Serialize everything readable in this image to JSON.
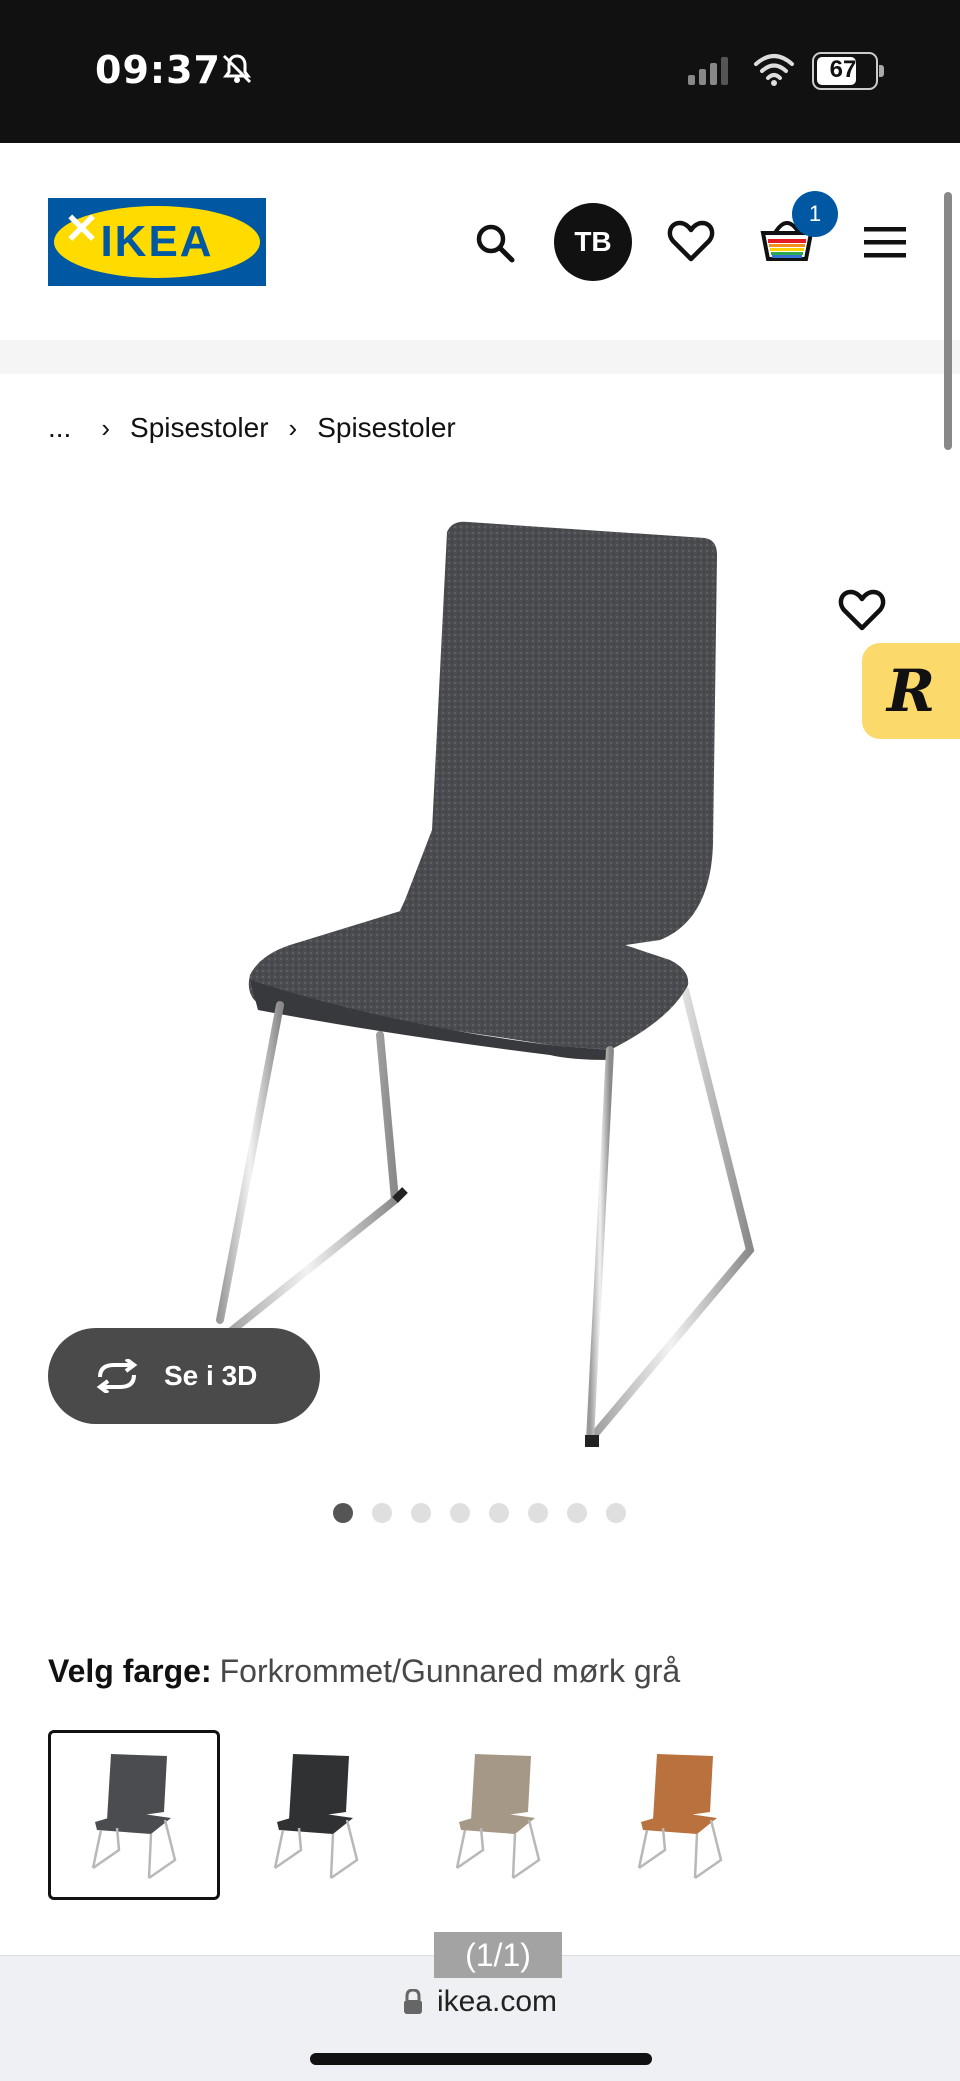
{
  "status_bar": {
    "time": "09:37",
    "battery": "67"
  },
  "header": {
    "logo_text": "IKEA",
    "avatar_initials": "TB",
    "cart_count": "1"
  },
  "breadcrumb": {
    "ellipsis": "...",
    "items": [
      "Spisestoler",
      "Spisestoler"
    ]
  },
  "product": {
    "view_3d_label": "Se i 3D",
    "image_count": 8,
    "active_image_index": 0,
    "reviews_badge": "R"
  },
  "color_select": {
    "label": "Velg farge:",
    "value": "Forkrommet/Gunnared mørk grå",
    "swatches": [
      {
        "color": "#4a4c50",
        "selected": true
      },
      {
        "color": "#2f3133",
        "selected": false
      },
      {
        "color": "#a69886",
        "selected": false
      },
      {
        "color": "#b9713d",
        "selected": false
      }
    ]
  },
  "browser": {
    "page_counter": "(1/1)",
    "url": "ikea.com"
  },
  "colors": {
    "ikea_blue": "#0058a3",
    "ikea_yellow": "#ffdb00",
    "seat_gray": "#4a4c50"
  }
}
